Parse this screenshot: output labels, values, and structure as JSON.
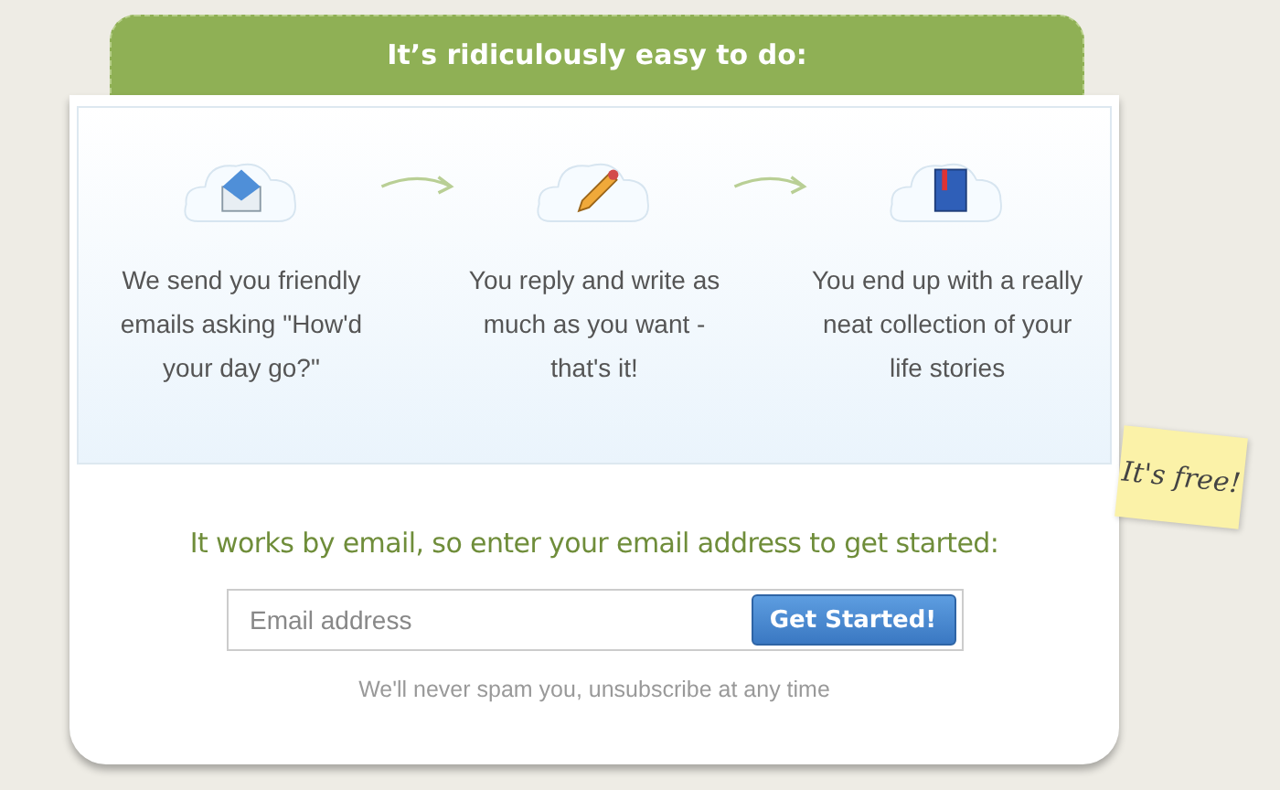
{
  "header": {
    "title": "It’s ridiculously easy to do:"
  },
  "steps": [
    {
      "kind": "envelope",
      "text": "We send you friendly emails asking \"How'd your day go?\""
    },
    {
      "kind": "pencil",
      "text": "You reply and write as much as you want - that's it!"
    },
    {
      "kind": "book",
      "text": "You end up with a really neat collection of your life stories"
    }
  ],
  "signup": {
    "prompt": "It works by email, so enter your email address to get started:",
    "email": {
      "placeholder": "Email address"
    },
    "button": "Get Started!",
    "note": "We'll never spam you, unsubscribe at any time"
  },
  "sticky_note": "It's free!"
}
